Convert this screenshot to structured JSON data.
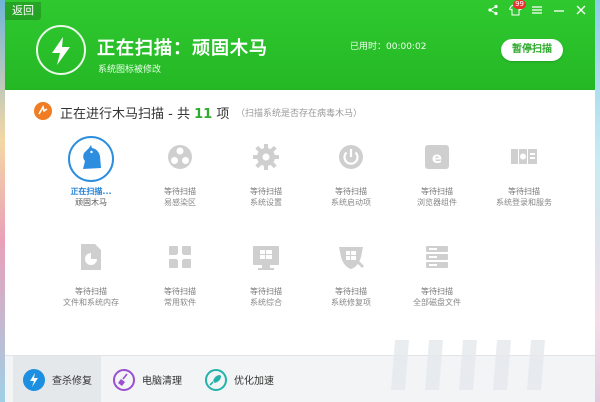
{
  "header": {
    "back_label": "返回",
    "scan_title": "正在扫描：顽固木马",
    "scan_subtitle": "系统图标被修改",
    "elapsed_label": "已用时：00:00:02",
    "pause_label": "暂停扫描",
    "notification_count": "99",
    "accent_color": "#2ec22e"
  },
  "section": {
    "title_prefix": "正在进行木马扫描 - 共",
    "count": "11",
    "title_suffix": "项",
    "hint": "（扫描系统是否存在病毒木马）"
  },
  "items": [
    {
      "status": "正在扫描...",
      "name": "顽固木马",
      "icon": "horse-icon"
    },
    {
      "status": "等待扫描",
      "name": "易感染区",
      "icon": "biohazard-icon"
    },
    {
      "status": "等待扫描",
      "name": "系统设置",
      "icon": "gear-icon"
    },
    {
      "status": "等待扫描",
      "name": "系统启动项",
      "icon": "power-icon"
    },
    {
      "status": "等待扫描",
      "name": "浏览器组件",
      "icon": "browser-icon"
    },
    {
      "status": "等待扫描",
      "name": "系统登录和服务",
      "icon": "login-service-icon"
    },
    {
      "status": "等待扫描",
      "name": "文件和系统内存",
      "icon": "file-memory-icon"
    },
    {
      "status": "等待扫描",
      "name": "常用软件",
      "icon": "apps-icon"
    },
    {
      "status": "等待扫描",
      "name": "系统综合",
      "icon": "windows-icon"
    },
    {
      "status": "等待扫描",
      "name": "系统修复项",
      "icon": "repair-icon"
    },
    {
      "status": "等待扫描",
      "name": "全部磁盘文件",
      "icon": "disk-icon"
    }
  ],
  "bottom_tabs": [
    {
      "label": "查杀修复",
      "icon": "bolt-icon",
      "color": "#1d8fe0"
    },
    {
      "label": "电脑清理",
      "icon": "broom-icon",
      "color": "#9b4fd1"
    },
    {
      "label": "优化加速",
      "icon": "rocket-icon",
      "color": "#24b3a8"
    }
  ]
}
